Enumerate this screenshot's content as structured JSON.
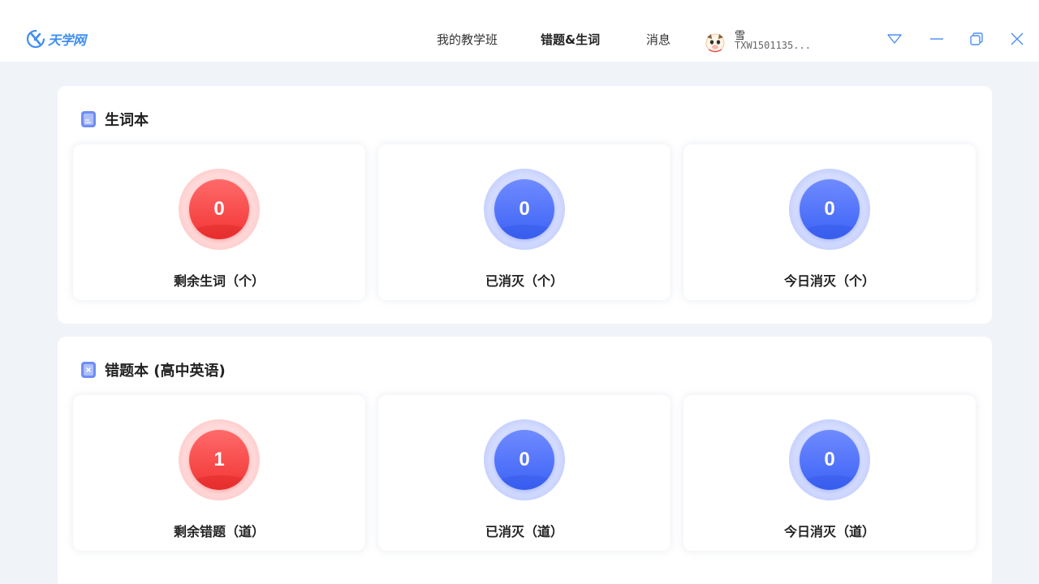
{
  "app": {
    "logo_text": "天学网"
  },
  "nav": {
    "items": [
      {
        "label": "我的教学班"
      },
      {
        "label": "错题&生词"
      },
      {
        "label": "消息"
      }
    ]
  },
  "user": {
    "name": "雪",
    "id": "TXW1501135..."
  },
  "vocab": {
    "title": "生词本",
    "stats": [
      {
        "value": "0",
        "label": "剩余生词（个）",
        "color": "#f23535"
      },
      {
        "value": "0",
        "label": "已消灭（个）",
        "color": "#3d63f6"
      },
      {
        "value": "0",
        "label": "今日消灭（个）",
        "color": "#3d63f6"
      }
    ]
  },
  "mistakes": {
    "title": "错题本 (高中英语)",
    "stats": [
      {
        "value": "1",
        "label": "剩余错题（道）",
        "color": "#f23535"
      },
      {
        "value": "0",
        "label": "已消灭（道）",
        "color": "#3d63f6"
      },
      {
        "value": "0",
        "label": "今日消灭（道）",
        "color": "#3d63f6"
      }
    ]
  },
  "icons": {
    "vocab": "notebook-icon",
    "mistakes": "mistake-book-icon",
    "window": [
      "dropdown-icon",
      "minimize-icon",
      "maximize-icon",
      "close-icon"
    ]
  }
}
